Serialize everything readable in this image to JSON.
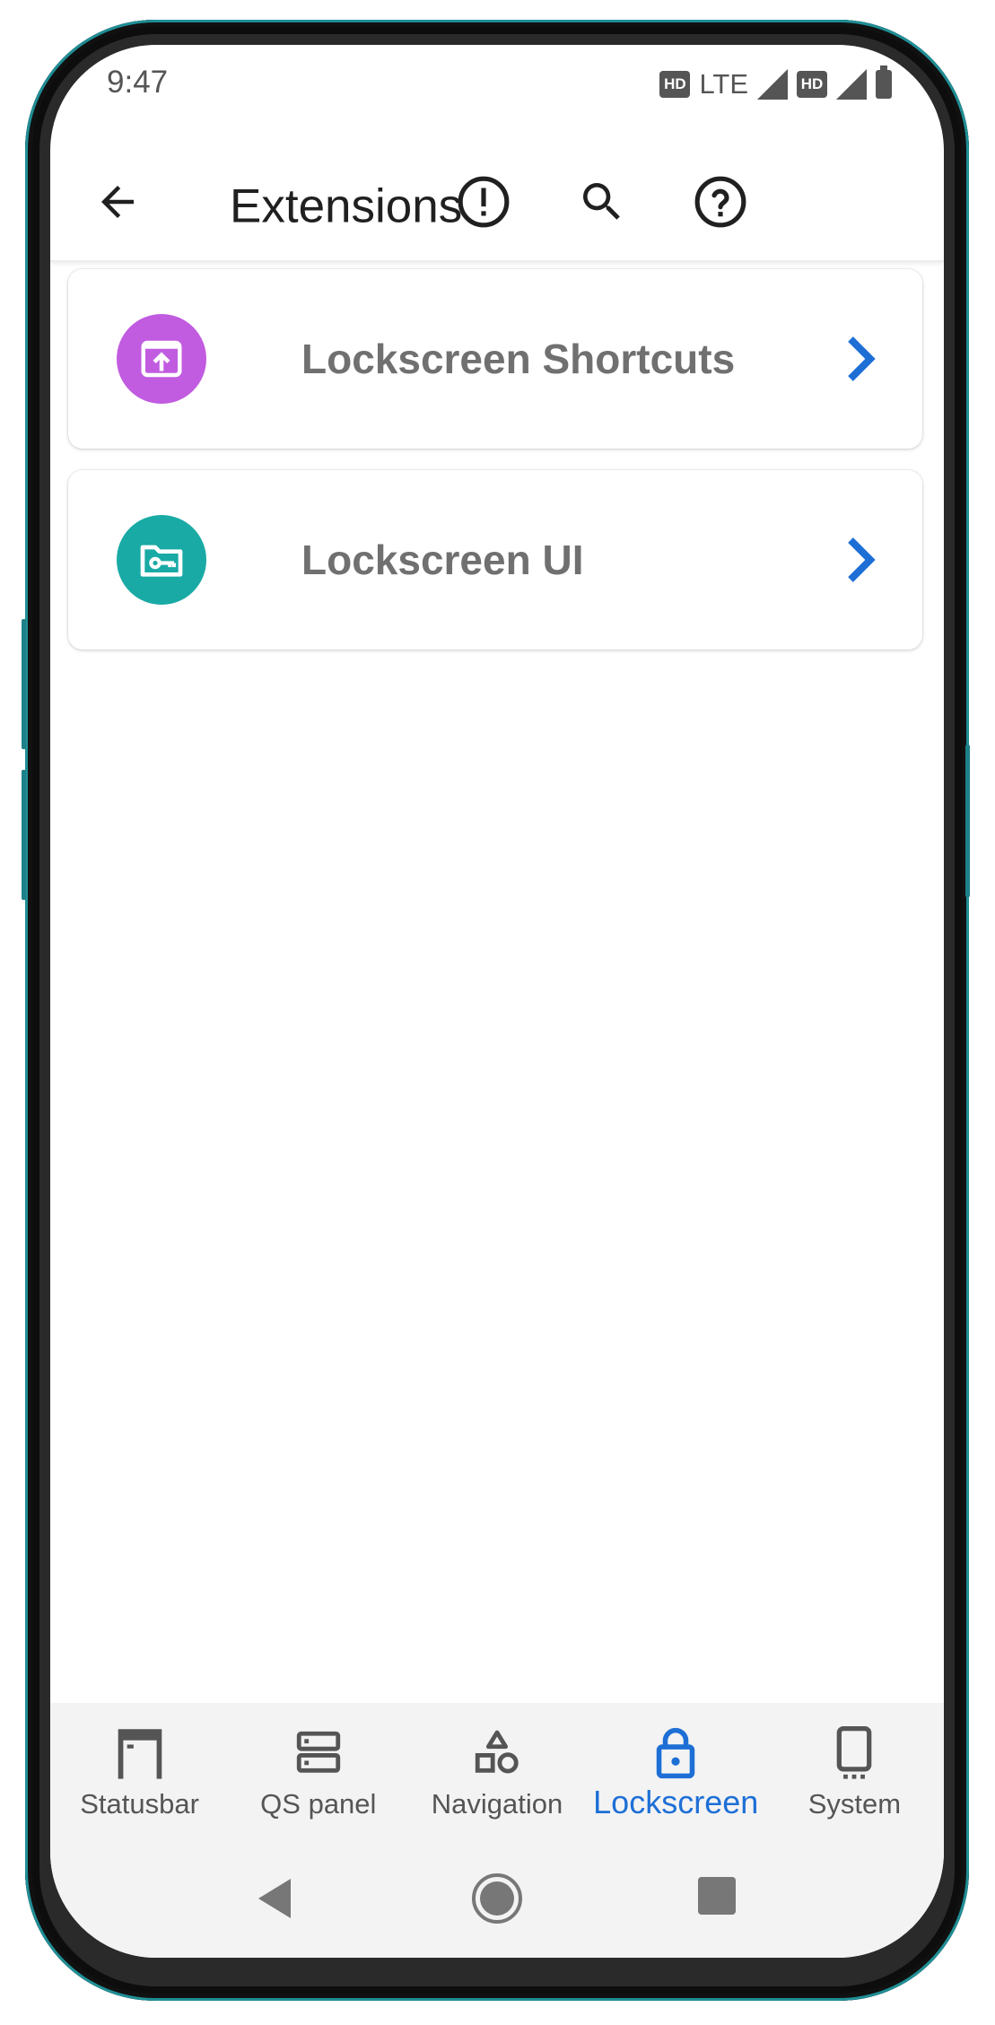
{
  "status_bar": {
    "time": "9:47",
    "hd_badge_1": "HD",
    "network": "LTE",
    "hd_badge_2": "HD"
  },
  "app_bar": {
    "title": "Extensions",
    "icons": [
      "back-arrow-icon",
      "alert-info-icon",
      "search-icon",
      "help-icon"
    ]
  },
  "cards": [
    {
      "label": "Lockscreen Shortcuts",
      "icon": "shortcuts-icon",
      "icon_color": "#c15be0"
    },
    {
      "label": "Lockscreen UI",
      "icon": "folder-key-icon",
      "icon_color": "#19aaa5"
    }
  ],
  "bottom_nav": {
    "items": [
      {
        "label": "Statusbar",
        "icon": "statusbar-icon",
        "active": false
      },
      {
        "label": "QS panel",
        "icon": "qs-panel-icon",
        "active": false
      },
      {
        "label": "Navigation",
        "icon": "navigation-icon",
        "active": false
      },
      {
        "label": "Lockscreen",
        "icon": "lock-icon",
        "active": true
      },
      {
        "label": "System",
        "icon": "phone-icon",
        "active": false
      }
    ]
  },
  "colors": {
    "accent": "#1d6fd6",
    "text_primary": "#202020",
    "text_secondary": "#707070"
  }
}
